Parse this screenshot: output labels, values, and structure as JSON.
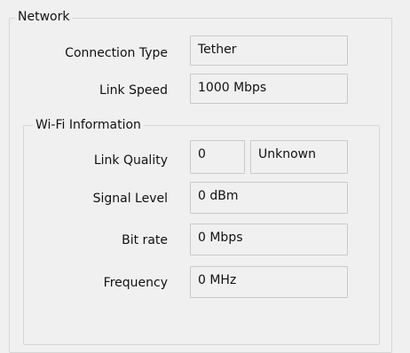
{
  "network": {
    "title": "Network",
    "connection_type_label": "Connection Type",
    "connection_type_value": "Tether",
    "link_speed_label": "Link Speed",
    "link_speed_value": "1000 Mbps"
  },
  "wifi": {
    "title": "Wi-Fi Information",
    "link_quality_label": "Link Quality",
    "link_quality_value": "0",
    "link_quality_status": "Unknown",
    "signal_level_label": "Signal Level",
    "signal_level_value": "0 dBm",
    "bit_rate_label": "Bit rate",
    "bit_rate_value": "0 Mbps",
    "frequency_label": "Frequency",
    "frequency_value": "0 MHz"
  }
}
